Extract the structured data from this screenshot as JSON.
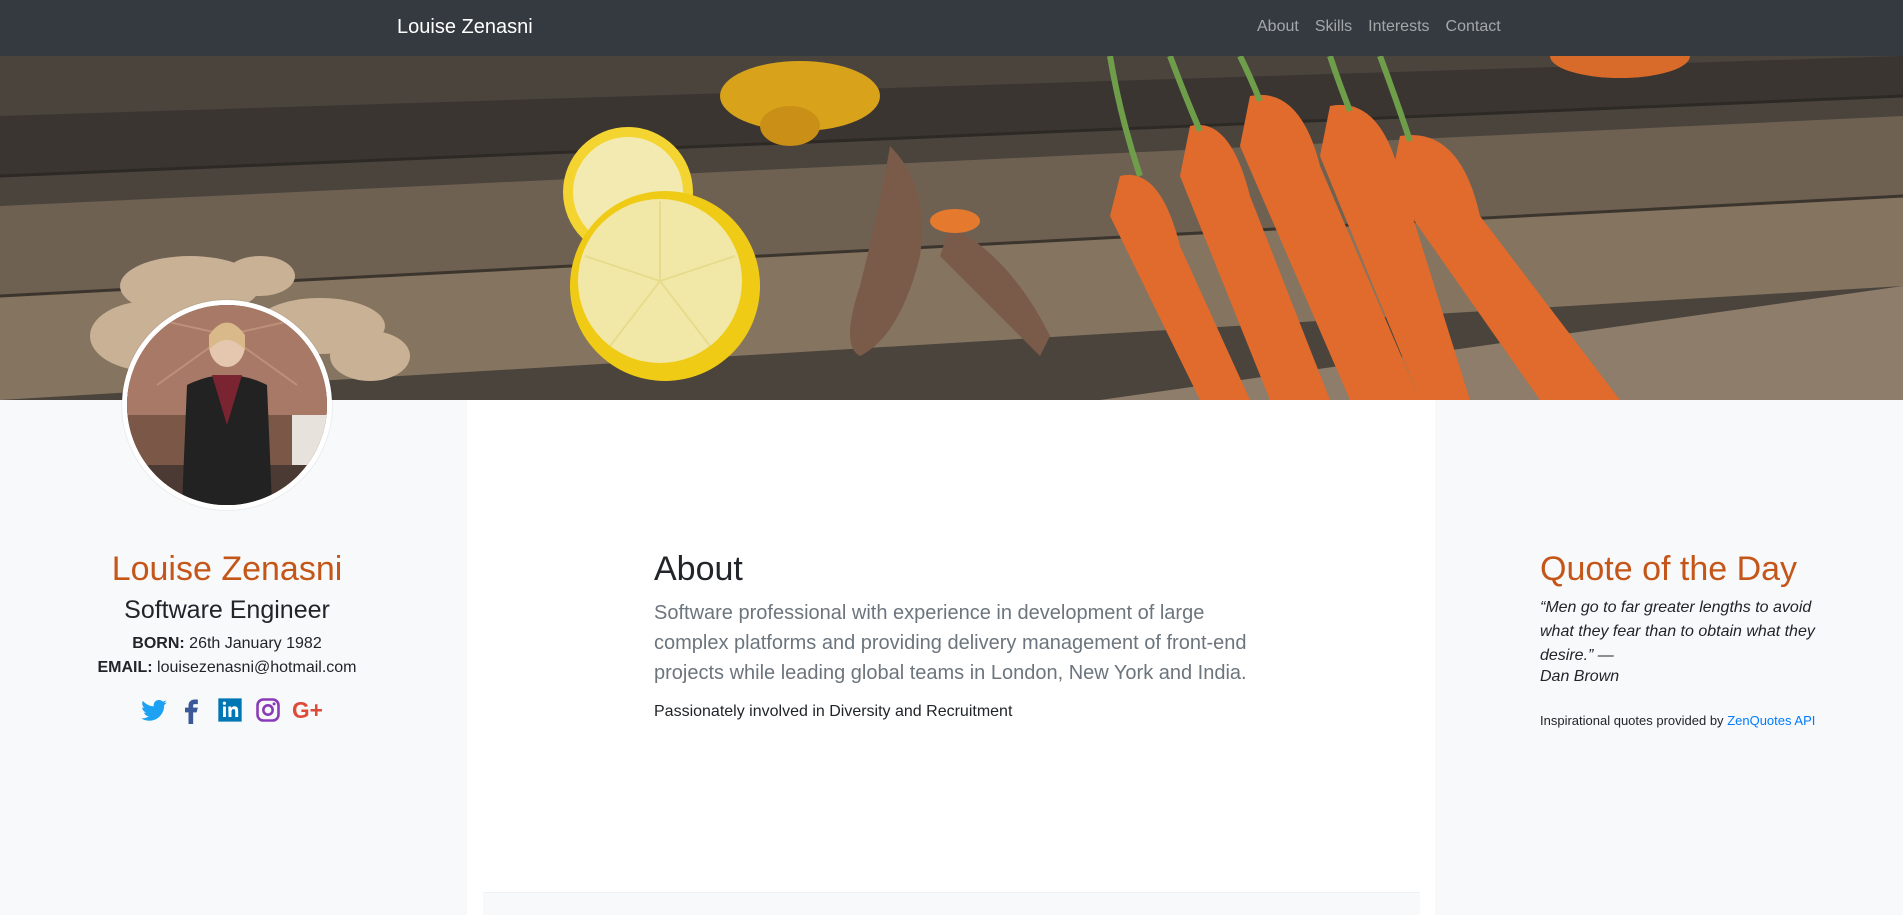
{
  "navbar": {
    "brand": "Louise Zenasni",
    "links": [
      "About",
      "Skills",
      "Interests",
      "Contact"
    ]
  },
  "profile": {
    "name": "Louise Zenasni",
    "title": "Software Engineer",
    "born_label": "BORN:",
    "born_value": "26th January 1982",
    "email_label": "EMAIL:",
    "email_value": "louisezenasni@hotmail.com",
    "socials": [
      {
        "icon": "twitter-icon",
        "color": "#1da1f2"
      },
      {
        "icon": "facebook-icon",
        "color": "#3b5998"
      },
      {
        "icon": "linkedin-icon",
        "color": "#0077b5"
      },
      {
        "icon": "instagram-icon",
        "color": "#8a3ab9"
      },
      {
        "icon": "google-plus-icon",
        "color": "#dd4b39"
      }
    ]
  },
  "about": {
    "heading": "About",
    "lead": "Software professional with experience in development of large complex platforms and providing delivery management of front-end projects while leading global teams in London, New York and India.",
    "sub": "Passionately involved in Diversity and Recruitment"
  },
  "quote": {
    "heading": "Quote of the Day",
    "text": "“Men go to far greater lengths to avoid what they fear than to obtain what they desire.” —",
    "author": "Dan Brown",
    "credit_prefix": "Inspirational quotes provided by ",
    "credit_link": "ZenQuotes API"
  },
  "colors": {
    "accent": "#c5561a",
    "navbar": "#343a40",
    "link": "#007bff"
  }
}
